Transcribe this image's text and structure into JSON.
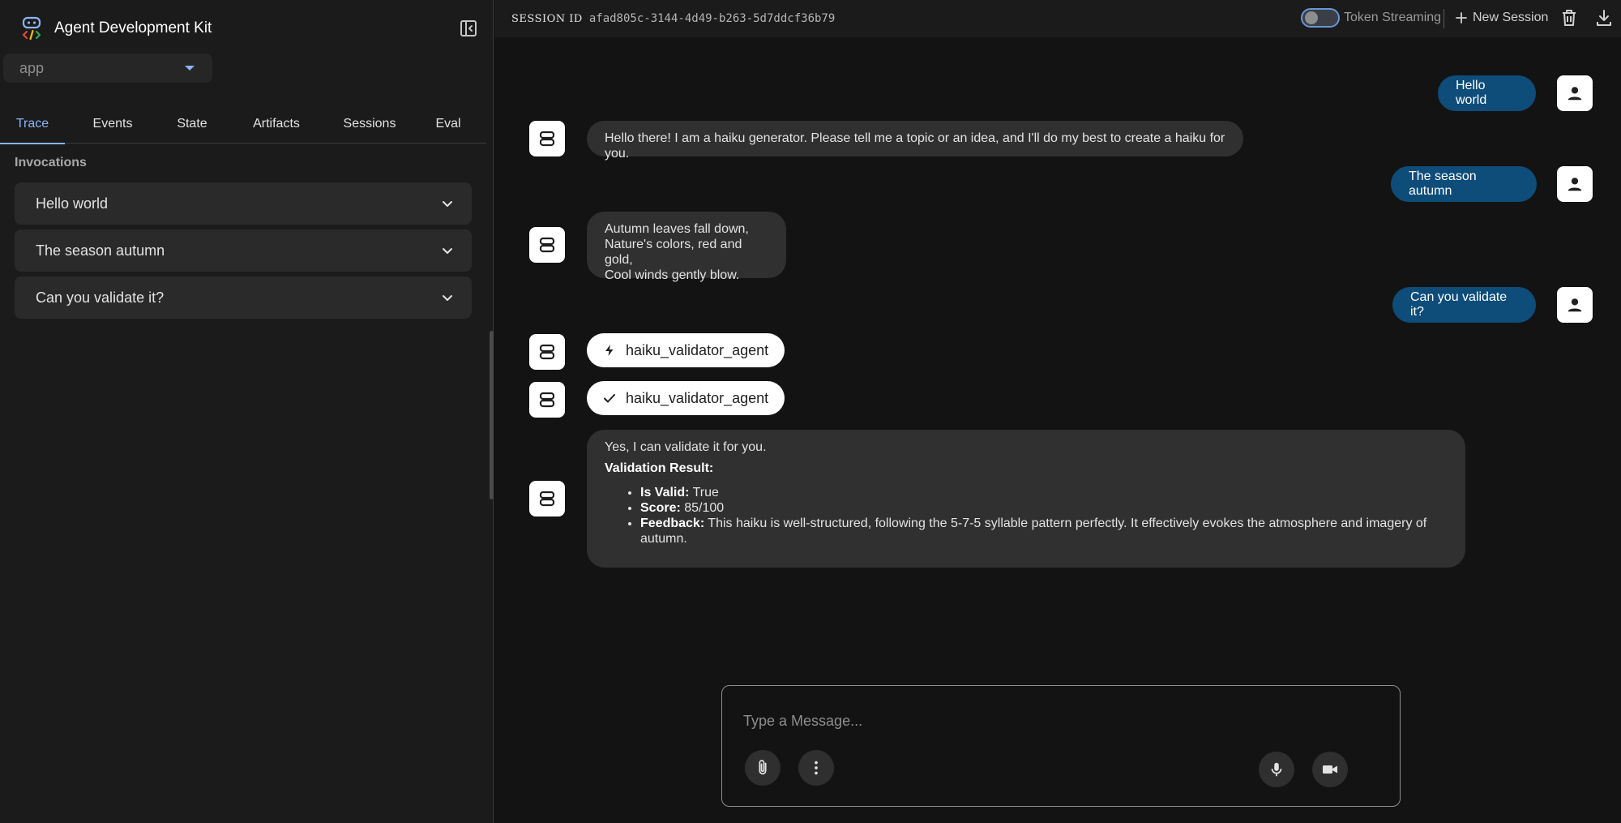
{
  "sidebar": {
    "title": "Agent Development Kit",
    "app_select": {
      "value": "app"
    },
    "tabs": [
      {
        "label": "Trace",
        "active": true
      },
      {
        "label": "Events"
      },
      {
        "label": "State"
      },
      {
        "label": "Artifacts"
      },
      {
        "label": "Sessions"
      },
      {
        "label": "Eval"
      }
    ],
    "invocations_title": "Invocations",
    "invocations": [
      {
        "label": "Hello world"
      },
      {
        "label": "The season autumn"
      },
      {
        "label": "Can you validate it?"
      }
    ]
  },
  "header": {
    "session_id_label": "SESSION ID",
    "session_id_value": "afad805c-3144-4d49-b263-5d7ddcf36b79",
    "token_streaming_label": "Token Streaming",
    "token_streaming_on": false,
    "new_session_label": "New Session"
  },
  "chat": {
    "messages": [
      {
        "role": "user",
        "text": "Hello world"
      },
      {
        "role": "bot",
        "text": "Hello there! I am a haiku generator. Please tell me a topic or an idea, and I'll do my best to create a haiku for you."
      },
      {
        "role": "user",
        "text": "The season autumn"
      },
      {
        "role": "bot",
        "lines": [
          "Autumn leaves fall down,",
          "Nature's colors, red and gold,",
          "Cool winds gently blow."
        ]
      },
      {
        "role": "user",
        "text": "Can you validate it?"
      },
      {
        "role": "function_call",
        "text": "haiku_validator_agent",
        "icon": "bolt-icon"
      },
      {
        "role": "function_response",
        "text": "haiku_validator_agent",
        "icon": "check-icon"
      },
      {
        "role": "bot",
        "intro": "Yes, I can validate it for you.",
        "heading": "Validation Result:",
        "items": [
          {
            "label": "Is Valid:",
            "value": " True"
          },
          {
            "label": "Score:",
            "value": " 85/100"
          },
          {
            "label": "Feedback:",
            "value": " This haiku is well-structured, following the 5-7-5 syllable pattern perfectly. It effectively evokes the atmosphere and imagery of autumn."
          }
        ]
      }
    ]
  },
  "composer": {
    "placeholder": "Type a Message..."
  },
  "colors": {
    "accent": "#8ab4f8",
    "user_bubble": "#0e4c7a",
    "bot_bubble": "#303030",
    "background": "#131314",
    "sidebar": "#1b1b1b"
  }
}
